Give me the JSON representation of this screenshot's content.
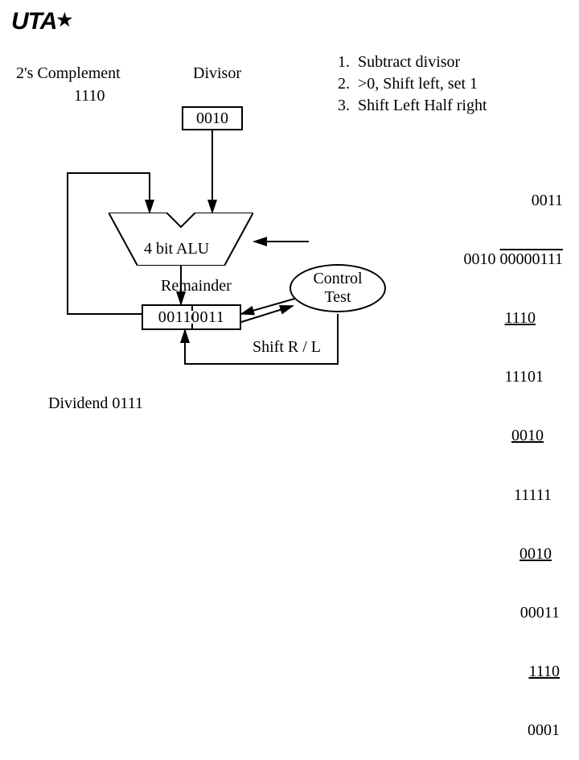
{
  "logo": "UTA",
  "twos_complement_label": "2's Complement",
  "twos_complement_value": "1110",
  "divisor_label": "Divisor",
  "divisor_value": "0010",
  "alu_label": "4 bit ALU",
  "remainder_label": "Remainder",
  "remainder_value": "00110011",
  "control_label_1": "Control",
  "control_label_2": "Test",
  "shift_label": "Shift R / L",
  "dividend_label": "Dividend 0111",
  "steps": {
    "n1": "1.",
    "s1": "Subtract divisor",
    "n2": "2.",
    "s2": ">0, Shift left, set 1",
    "n3": "3.",
    "s3": "Shift Left Half right"
  },
  "worked": {
    "quotient": "0011",
    "divisor": "0010",
    "dividend": "00000111",
    "l1": "1110",
    "l2": "11101",
    "l3": "0010",
    "l4": "11111",
    "l5": "0010",
    "l6": "00011",
    "l7": "1110",
    "l8": "0001"
  }
}
